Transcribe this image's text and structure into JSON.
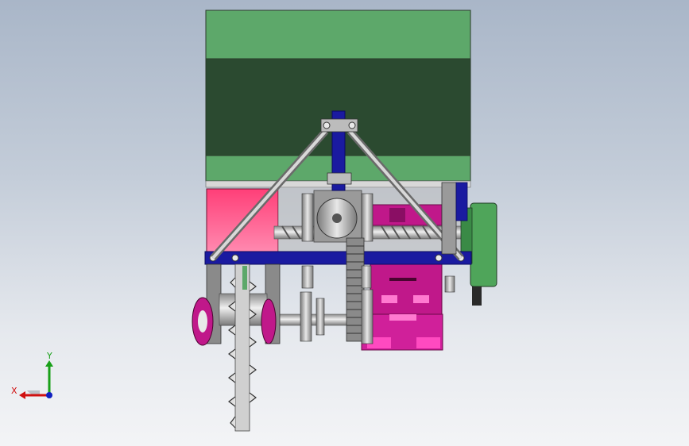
{
  "triad": {
    "x_label": "X",
    "y_label": "Y",
    "x_color": "#d01010",
    "y_color": "#18a018",
    "z_color": "#1020c0"
  },
  "model": {
    "hopper_light_color": "#5da86a",
    "hopper_dark_color": "#2a4b31",
    "frame_color": "#1a1aa0",
    "red_block_color": "#ff2a6a",
    "magenta_color": "#c0188a",
    "steel_color": "#b8b8b8",
    "motor_color": "#4fa55a"
  }
}
